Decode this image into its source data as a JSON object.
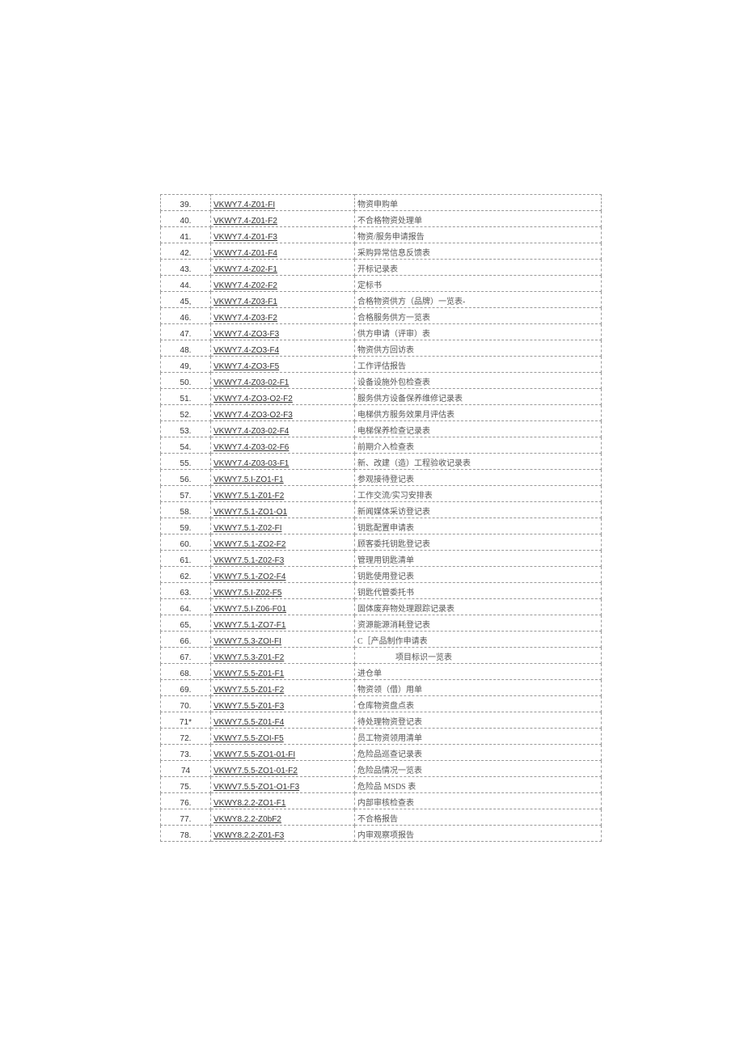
{
  "rows": [
    {
      "num": "39.",
      "code": "VKWY7.4-Z01-FI",
      "desc": "物资申购单",
      "indent": false
    },
    {
      "num": "40.",
      "code": "VKWY7.4-Z01-F2",
      "desc": "不合格物资处理单",
      "indent": false
    },
    {
      "num": "41.",
      "code": "VKWY7.4-Z01-F3",
      "desc": "物资/服务申请报告",
      "indent": false
    },
    {
      "num": "42.",
      "code": "VKWY7.4-Z01-F4",
      "desc": "采购异常信息反馈表",
      "indent": false
    },
    {
      "num": "43.",
      "code": "VKWY7.4-Z02-F1",
      "desc": "开标记录表",
      "indent": false
    },
    {
      "num": "44.",
      "code": "VKWY7.4-Z02-F2",
      "desc": "定标书",
      "indent": false
    },
    {
      "num": "45,",
      "code": "VKWY7.4-Z03-F1",
      "desc": "合格物资供方（品牌）一览表-",
      "indent": false
    },
    {
      "num": "46.",
      "code": "VKWY7.4-Z03-F2",
      "desc": "合格服务供方一览表",
      "indent": false
    },
    {
      "num": "47.",
      "code": "VKWY7.4-ZO3-F3",
      "desc": "供方申请（评审）表",
      "indent": false
    },
    {
      "num": "48.",
      "code": "VKWY7.4-ZO3-F4",
      "desc": "物资供方回访表",
      "indent": false
    },
    {
      "num": "49,",
      "code": "VKWY7.4-ZO3-F5",
      "desc": "工作评估报告",
      "indent": false
    },
    {
      "num": "50.",
      "code": "VKWY7.4-Z03-02-F1",
      "desc": "设备设施外包检查表",
      "indent": false
    },
    {
      "num": "51.",
      "code": "VKWY7.4-ZO3-O2-F2",
      "desc": "服务供方设备保养维修记录表",
      "indent": false
    },
    {
      "num": "52.",
      "code": "VKWY7.4-ZO3-O2-F3",
      "desc": "电梯供方服务效果月评估表",
      "indent": false
    },
    {
      "num": "53.",
      "code": "VKWY7.4-Z03-02-F4",
      "desc": "电梯保养检查记录表",
      "indent": false
    },
    {
      "num": "54.",
      "code": "VKWY7.4-Z03-02-F6",
      "desc": "前期介入检查表",
      "indent": false
    },
    {
      "num": "55.",
      "code": "VKWY7.4-Z03-03-F1",
      "desc": "新、改建（造）工程验收记录表",
      "indent": false
    },
    {
      "num": "56.",
      "code": "VKWY7.5.I-ZO1-F1",
      "desc": "参观接待登记表",
      "indent": false
    },
    {
      "num": "57.",
      "code": "VKWY7.5.1-Z01-F2",
      "desc": "工作交流/实习安排表",
      "indent": false
    },
    {
      "num": "58.",
      "code": "VKWY7.5.1-ZO1-O1",
      "desc": "新闻媒体采访登记表",
      "indent": false
    },
    {
      "num": "59.",
      "code": "VKWY7.5.1-Z02-FI",
      "desc": "钥匙配置申请表",
      "indent": false
    },
    {
      "num": "60.",
      "code": "VKWY7.5.1-ZO2-F2",
      "desc": "顾客委托钥匙登记表",
      "indent": false
    },
    {
      "num": "61.",
      "code": "VKWY7.5.1-Z02-F3",
      "desc": "管理用钥匙清单",
      "indent": false
    },
    {
      "num": "62.",
      "code": "VKWY7.5.1-ZO2-F4",
      "desc": "钥匙使用登记表",
      "indent": false
    },
    {
      "num": "63.",
      "code": "VKWY7.5.I-Z02-F5",
      "desc": "钥匙代管委托书",
      "indent": false
    },
    {
      "num": "64.",
      "code": "VKWY7.5.I-Z06-F01",
      "desc": "固体废弃物处理跟踪记录表",
      "indent": false
    },
    {
      "num": "65,",
      "code": "VKWY7.5.1-ZO7-F1",
      "desc": "资源能源消耗登记表",
      "indent": false
    },
    {
      "num": "66.",
      "code": "VKWY7.5.3-ZOI-FI",
      "desc": "C［产品制作申请表",
      "indent": false
    },
    {
      "num": "67.",
      "code": "VKWY7.5.3-Z01-F2",
      "desc": "项目标识一览表",
      "indent": true
    },
    {
      "num": "68.",
      "code": "VKWY7.5.5-Z01-F1",
      "desc": "进仓单",
      "indent": false
    },
    {
      "num": "69.",
      "code": "VKWY7.5.5-Z01-F2",
      "desc": "物资领（借）用单",
      "indent": false
    },
    {
      "num": "70.",
      "code": "VKWY7.5.5-Z01-F3",
      "desc": "仓库物资盘点表",
      "indent": false
    },
    {
      "num": "71*",
      "code": "VKWY7.5.5-Z01-F4",
      "desc": "待处理物资登记表",
      "indent": false
    },
    {
      "num": "72.",
      "code": "VKWY7.5.5-ZOI-F5",
      "desc": "员工物资领用清单",
      "indent": false
    },
    {
      "num": "73.",
      "code": "VKWY7.5.5-ZO1-01-FI",
      "desc": "危险品巡查记录表",
      "indent": false
    },
    {
      "num": "74",
      "code": "VKWY7.5.5-ZO1-01-F2",
      "desc": "危险品情况一览表",
      "indent": false
    },
    {
      "num": "75.",
      "code": "VKWV7.5.5-ZO1-O1-F3",
      "desc": "危险品 MSDS 表",
      "indent": false
    },
    {
      "num": "76.",
      "code": "VKWY8.2.2-ZO1-F1",
      "desc": "内部审核检查表",
      "indent": false
    },
    {
      "num": "77.",
      "code": "VKWY8.2.2-Z0bF2",
      "desc": "不合格报告",
      "indent": false
    },
    {
      "num": "78.",
      "code": "VKWY8.2.2-Z01-F3",
      "desc": "内审观察项报告",
      "indent": false
    }
  ]
}
